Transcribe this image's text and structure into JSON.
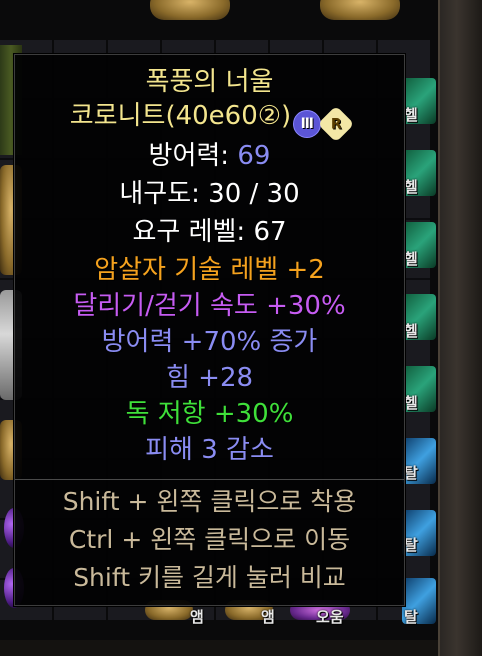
{
  "item": {
    "name": "폭풍의 너울",
    "base_type": "코로니트(40e60②)",
    "tier_badge": "Ⅲ",
    "rarity_badge": "R"
  },
  "stats": {
    "armor_label": "방어력:",
    "armor_value": "69",
    "durability": "내구도: 30 / 30",
    "required_level": "요구 레벨: 67"
  },
  "affixes": [
    {
      "text": "암살자 기술 레벨 +2",
      "color": "#f5a21e"
    },
    {
      "text": "달리기/걷기 속도 +30%",
      "color": "#c65cf2"
    },
    {
      "text": "방어력 +70% 증가",
      "color": "#8a8cf2"
    },
    {
      "text": "힘 +28",
      "color": "#8a8cf2"
    },
    {
      "text": "독 저항 +30%",
      "color": "#3fe03a"
    },
    {
      "text": "피해 3 감소",
      "color": "#8a8cf2"
    }
  ],
  "hints": [
    "Shift + 왼쪽 클릭으로 착용",
    "Ctrl + 왼쪽 클릭으로 이동",
    "Shift 키를 길게 눌러 비교"
  ],
  "inventory_labels": {
    "right_column": [
      "헬",
      "헬",
      "헬",
      "헬",
      "헬",
      "탈",
      "탈",
      "탈"
    ],
    "bottom_row": [
      "앰",
      "앰",
      "오움"
    ]
  },
  "colors": {
    "title": "#f3e58e",
    "stat_value": "#8a8cf2",
    "hint": "#c9b99a"
  }
}
